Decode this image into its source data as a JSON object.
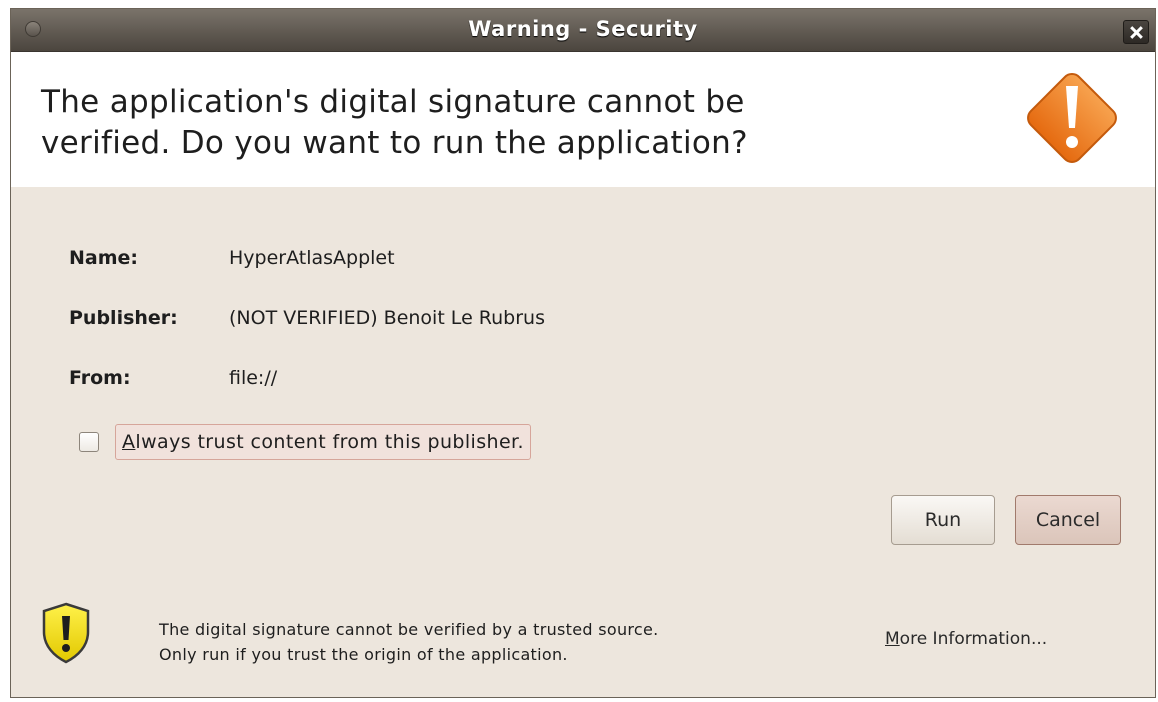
{
  "window": {
    "title": "Warning - Security",
    "close_icon": "close-icon"
  },
  "header": {
    "message_line1": "The application's digital signature cannot be",
    "message_line2": "verified.  Do you want to run the application?",
    "icon": "warning-diamond-icon",
    "icon_color": "#f07a1e"
  },
  "details": {
    "name_label": "Name:",
    "name_value": "HyperAtlasApplet",
    "publisher_label": "Publisher:",
    "publisher_value": "(NOT VERIFIED) Benoit Le Rubrus",
    "from_label": "From:",
    "from_value": "file://"
  },
  "trust_checkbox": {
    "checked": false,
    "mnemonic": "A",
    "label_rest": "lways trust content from this publisher."
  },
  "buttons": {
    "run": "Run",
    "cancel": "Cancel"
  },
  "footer": {
    "icon": "warning-shield-icon",
    "icon_color": "#f2e200",
    "line1": "The digital signature cannot be verified by a trusted source.",
    "line2": "Only run if you trust the origin of the application.",
    "more_info_mnemonic": "M",
    "more_info_rest": "ore Information..."
  }
}
